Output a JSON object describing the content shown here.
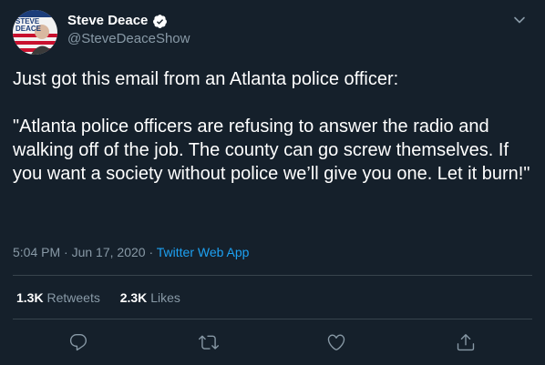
{
  "author": {
    "display_name": "Steve Deace",
    "handle": "@SteveDeaceShow",
    "verified": true,
    "avatar_text_top": "STEVE",
    "avatar_text_bottom": "DEACE"
  },
  "tweet": {
    "text": "Just got this email from an Atlanta police officer:\n\n\"Atlanta police officers are refusing to answer the radio and walking off of the job. The county can go screw themselves. If you want a society without police we’ll give you one. Let it burn!\"",
    "time": "5:04 PM",
    "separator": "·",
    "date": "Jun 17, 2020",
    "source": "Twitter Web App"
  },
  "stats": {
    "retweets_count": "1.3K",
    "retweets_label": "Retweets",
    "likes_count": "2.3K",
    "likes_label": "Likes"
  },
  "icons": {
    "reply": "reply-icon",
    "retweet": "retweet-icon",
    "like": "heart-icon",
    "share": "share-icon",
    "menu": "chevron-down-icon",
    "verified": "verified-badge-icon"
  },
  "colors": {
    "background": "#15202b",
    "secondary_text": "#8899a6",
    "link": "#1da1f2",
    "divider": "#38444d"
  }
}
